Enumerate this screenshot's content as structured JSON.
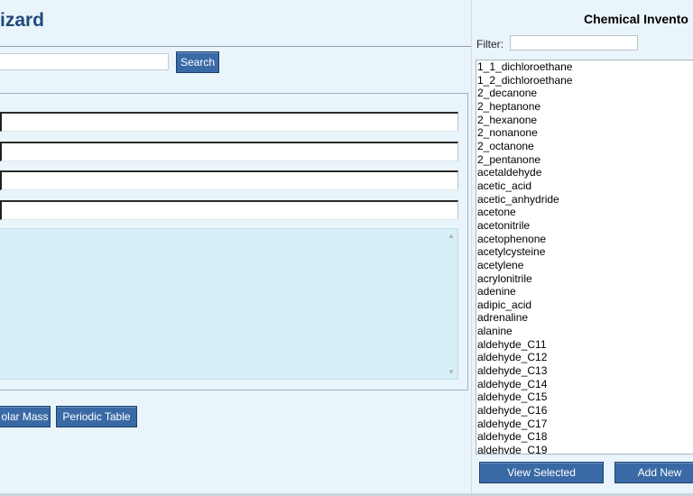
{
  "left": {
    "title": "izard",
    "search_button": "Search",
    "mass_button": "olar Mass",
    "periodic_button": "Periodic Table",
    "search_value": "",
    "fields": [
      "",
      "",
      "",
      ""
    ],
    "notes_value": ""
  },
  "right": {
    "title": "Chemical Invento",
    "filter_label": "Filter:",
    "filter_value": "",
    "items": [
      "1_1_dichloroethane",
      "1_2_dichloroethane",
      "2_decanone",
      "2_heptanone",
      "2_hexanone",
      "2_nonanone",
      "2_octanone",
      "2_pentanone",
      "acetaldehyde",
      "acetic_acid",
      "acetic_anhydride",
      "acetone",
      "acetonitrile",
      "acetophenone",
      "acetylcysteine",
      "acetylene",
      "acrylonitrile",
      "adenine",
      "adipic_acid",
      "adrenaline",
      "alanine",
      "aldehyde_C11",
      "aldehyde_C12",
      "aldehyde_C13",
      "aldehyde_C14",
      "aldehyde_C15",
      "aldehyde_C16",
      "aldehyde_C17",
      "aldehyde_C18",
      "aldehyde_C19"
    ],
    "view_button": "View Selected",
    "add_button": "Add New"
  },
  "colors": {
    "accent": "#3a6aa6",
    "title": "#1f4a7c",
    "background": "#eaf4fb",
    "notes": "#d7f0f8"
  }
}
